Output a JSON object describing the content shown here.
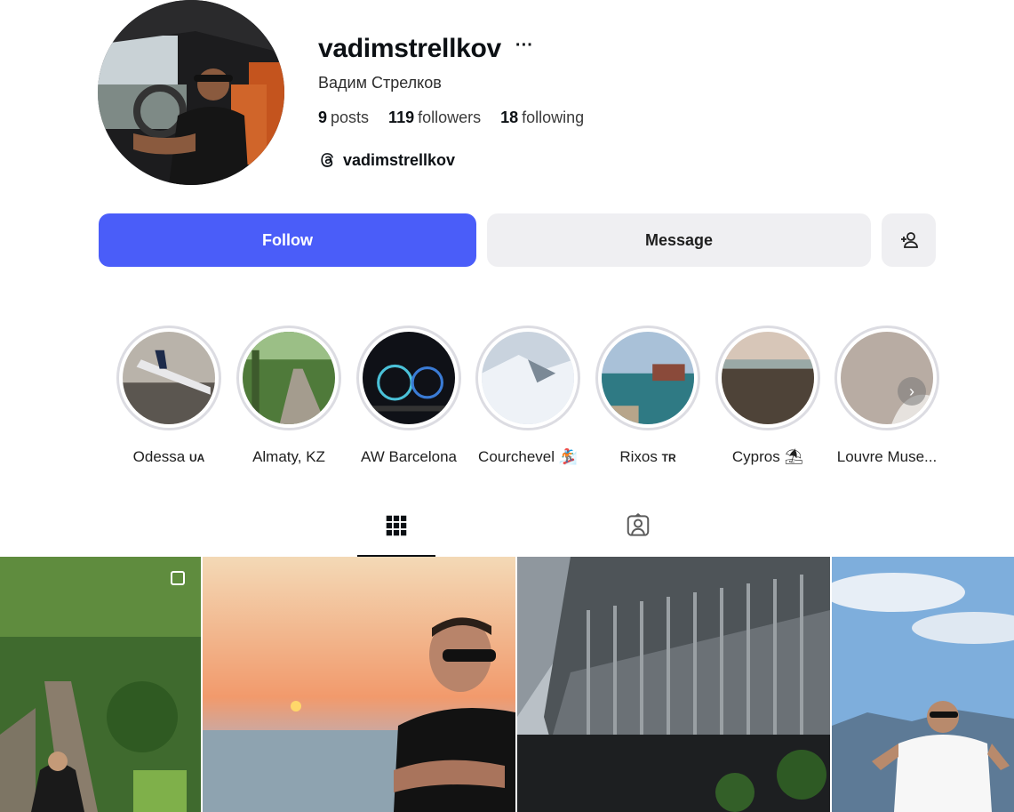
{
  "profile": {
    "username": "vadimstrellkov",
    "more_label": "···",
    "full_name": "Вадим Стрелков",
    "stats": {
      "posts_count": "9",
      "posts_label": "posts",
      "followers_count": "119",
      "followers_label": "followers",
      "following_count": "18",
      "following_label": "following"
    },
    "threads_handle": "vadimstrellkov"
  },
  "actions": {
    "follow_label": "Follow",
    "message_label": "Message",
    "add_user_icon": "add-user-icon"
  },
  "highlights": [
    {
      "label": "Odessa",
      "suffix": "UA"
    },
    {
      "label": "Almaty, KZ",
      "suffix": ""
    },
    {
      "label": "AW Barcelona",
      "suffix": ""
    },
    {
      "label": "Courchevel",
      "suffix": "🏂"
    },
    {
      "label": "Rixos",
      "suffix": "TR"
    },
    {
      "label": "Cypros",
      "suffix": "⛱"
    },
    {
      "label": "Louvre Muse...",
      "suffix": ""
    }
  ],
  "tabs": {
    "posts_icon": "grid-icon",
    "tagged_icon": "tagged-icon"
  },
  "colors": {
    "follow_blue": "#4a5df9",
    "button_gray": "#efeff2",
    "ring_gray": "#dcdce2"
  }
}
